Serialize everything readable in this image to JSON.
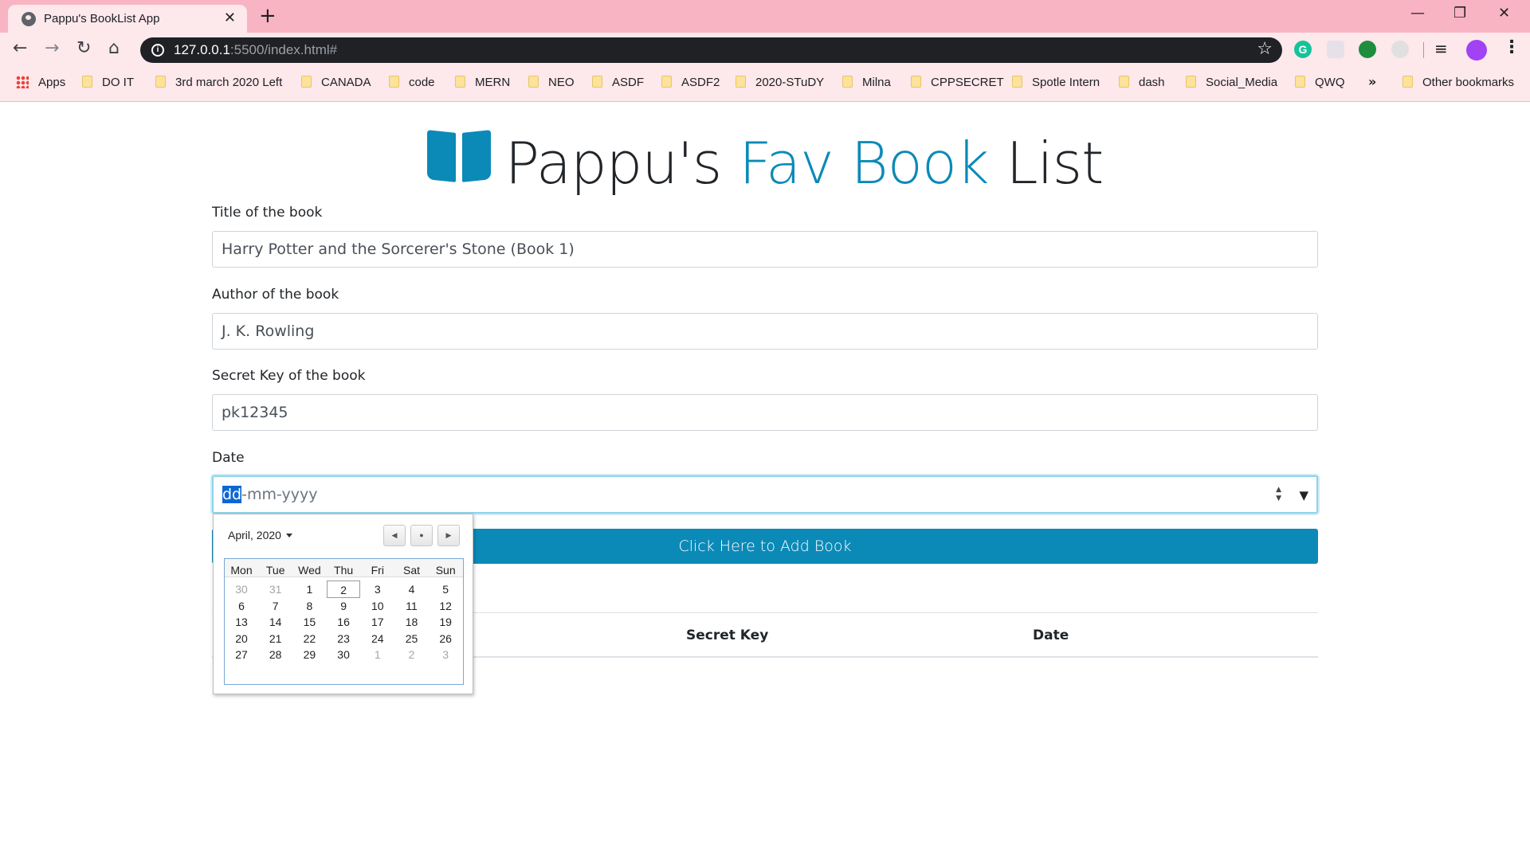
{
  "browser": {
    "tab_title": "Pappu's BookList App",
    "tab_close": "✕",
    "new_tab": "+",
    "window_controls": {
      "minimize": "—",
      "maximize": "❐",
      "close": "✕"
    },
    "url_host": "127.0.0.1",
    "url_path": ":5500/index.html#",
    "icons": {
      "back": "arrow-left-icon",
      "forward": "arrow-right-icon",
      "reload": "reload-icon",
      "home": "home-icon",
      "info": "info-icon",
      "star": "star-icon"
    },
    "bookmarks": [
      "Apps",
      "DO IT",
      "3rd march 2020 Left",
      "CANADA",
      "code",
      "MERN",
      "NEO",
      "ASDF",
      "ASDF2",
      "2020-STuDY",
      "Milna",
      "CPPSECRET",
      "Spotle Intern",
      "dash",
      "Social_Media",
      "QWQ"
    ],
    "bookmarks_overflow": "»",
    "other_bookmarks": "Other bookmarks"
  },
  "page": {
    "heading_part1": "Pappu's ",
    "heading_fav": "Fav ",
    "heading_book": "Book",
    "heading_list": " List",
    "accent_color": "#0b8ab8",
    "form": {
      "title_label": "Title of the book",
      "title_value": "Harry Potter and the Sorcerer's Stone (Book 1)",
      "author_label": "Author of the book",
      "author_value": "J. K. Rowling",
      "key_label": "Secret Key of the book",
      "key_value": "pk12345",
      "date_label": "Date",
      "date_selected_segment": "dd",
      "date_rest": "-mm-yyyy",
      "submit_label": "Click Here to Add Book"
    },
    "table_headers": [
      "Secret Key",
      "Date"
    ]
  },
  "datepicker": {
    "month_label": "April, 2020",
    "weekdays": [
      "Mon",
      "Tue",
      "Wed",
      "Thu",
      "Fri",
      "Sat",
      "Sun"
    ],
    "weeks": [
      [
        "30",
        "31",
        "1",
        "2",
        "3",
        "4",
        "5"
      ],
      [
        "6",
        "7",
        "8",
        "9",
        "10",
        "11",
        "12"
      ],
      [
        "13",
        "14",
        "15",
        "16",
        "17",
        "18",
        "19"
      ],
      [
        "20",
        "21",
        "22",
        "23",
        "24",
        "25",
        "26"
      ],
      [
        "27",
        "28",
        "29",
        "30",
        "1",
        "2",
        "3"
      ]
    ],
    "today": "2"
  }
}
